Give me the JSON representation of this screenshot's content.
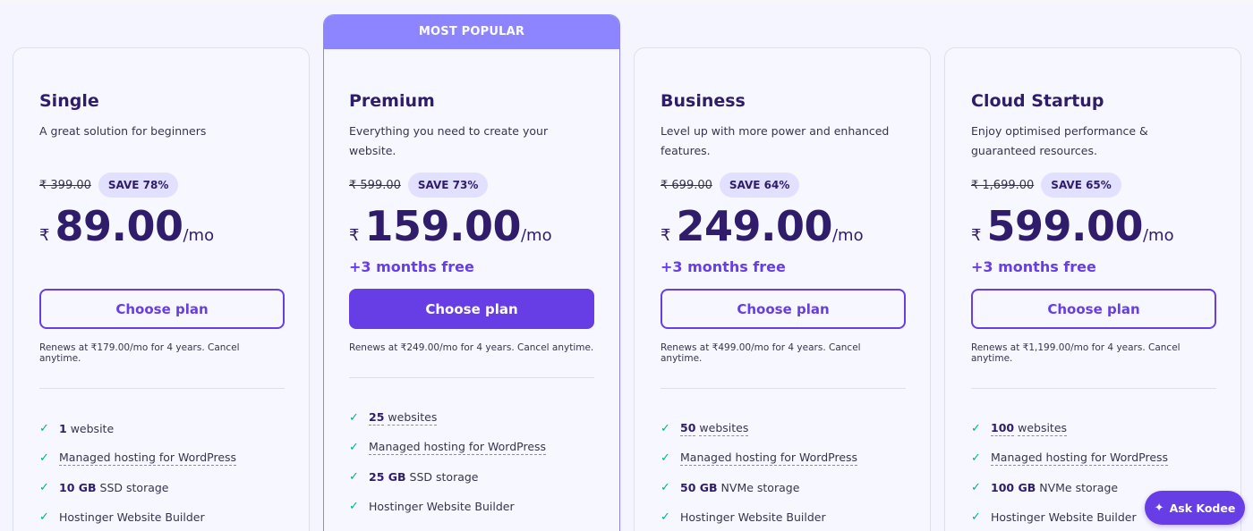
{
  "plans": [
    {
      "name": "Single",
      "description": "A great solution for beginners",
      "old_price": "₹ 399.00",
      "save": "SAVE 78%",
      "currency": "₹",
      "price": "89.00",
      "per": "/mo",
      "bonus": "",
      "button": "Choose plan",
      "renew": "Renews at ₹179.00/mo for 4 years. Cancel anytime.",
      "features": [
        {
          "bold": "1",
          "text": "website",
          "dashed": false
        },
        {
          "bold": "",
          "text": "Managed hosting for WordPress",
          "dashed": true
        },
        {
          "bold": "10 GB",
          "text": "SSD storage",
          "dashed": false
        },
        {
          "bold": "",
          "text": "Hostinger Website Builder",
          "dashed": false
        }
      ]
    },
    {
      "banner": "MOST POPULAR",
      "name": "Premium",
      "description": "Everything you need to create your website.",
      "old_price": "₹ 599.00",
      "save": "SAVE 73%",
      "currency": "₹",
      "price": "159.00",
      "per": "/mo",
      "bonus": "+3 months free",
      "button": "Choose plan",
      "renew": "Renews at ₹249.00/mo for 4 years. Cancel anytime.",
      "features": [
        {
          "bold": "25",
          "text": "websites",
          "dashed": true
        },
        {
          "bold": "",
          "text": "Managed hosting for WordPress",
          "dashed": true
        },
        {
          "bold": "25 GB",
          "text": "SSD storage",
          "dashed": false
        },
        {
          "bold": "",
          "text": "Hostinger Website Builder",
          "dashed": false
        }
      ]
    },
    {
      "name": "Business",
      "description": "Level up with more power and enhanced features.",
      "old_price": "₹ 699.00",
      "save": "SAVE 64%",
      "currency": "₹",
      "price": "249.00",
      "per": "/mo",
      "bonus": "+3 months free",
      "button": "Choose plan",
      "renew": "Renews at ₹499.00/mo for 4 years. Cancel anytime.",
      "features": [
        {
          "bold": "50",
          "text": "websites",
          "dashed": true
        },
        {
          "bold": "",
          "text": "Managed hosting for WordPress",
          "dashed": true
        },
        {
          "bold": "50 GB",
          "text": "NVMe storage",
          "dashed": false
        },
        {
          "bold": "",
          "text": "Hostinger Website Builder",
          "dashed": false
        }
      ]
    },
    {
      "name": "Cloud Startup",
      "description": "Enjoy optimised performance & guaranteed resources.",
      "old_price": "₹ 1,699.00",
      "save": "SAVE 65%",
      "currency": "₹",
      "price": "599.00",
      "per": "/mo",
      "bonus": "+3 months free",
      "button": "Choose plan",
      "renew": "Renews at ₹1,199.00/mo for 4 years. Cancel anytime.",
      "features": [
        {
          "bold": "100",
          "text": "websites",
          "dashed": true
        },
        {
          "bold": "",
          "text": "Managed hosting for WordPress",
          "dashed": true
        },
        {
          "bold": "100 GB",
          "text": "NVMe storage",
          "dashed": false
        },
        {
          "bold": "",
          "text": "Hostinger Website Builder",
          "dashed": false
        }
      ]
    }
  ],
  "check_icon": "check-icon",
  "ask_button": {
    "label": "Ask Kodee",
    "icon": "sparkle-icon"
  },
  "colors": {
    "accent": "#673de6",
    "banner": "#8c85ff",
    "check": "#00b090",
    "text": "#2f1c6a"
  }
}
